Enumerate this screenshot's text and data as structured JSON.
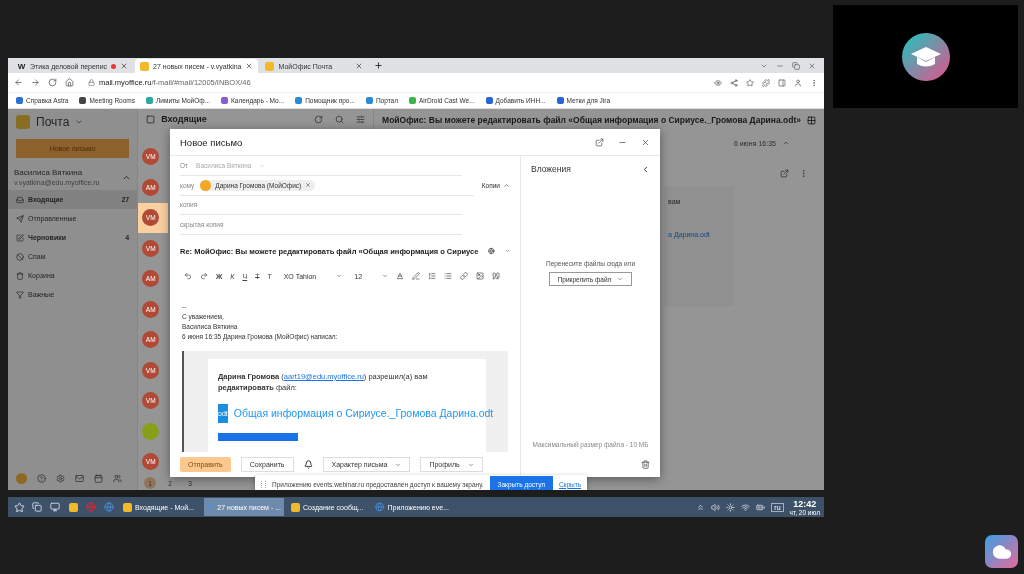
{
  "browser": {
    "tabs": [
      {
        "label": "Этика деловой перепис",
        "icon_text": "W",
        "kind": "doc",
        "recording": true,
        "selected": false
      },
      {
        "label": "27 новых писем - v.vyatkina",
        "kind": "mail",
        "recording": false,
        "selected": true
      },
      {
        "label": "МойОфис Почта",
        "kind": "mail",
        "recording": false,
        "selected": false
      }
    ],
    "url_host": "mail.myoffice.ru",
    "url_path": "/f-mail/#mail/12005/INBOX/46",
    "bookmarks": [
      "Справка Astra",
      "Meeting Rooms",
      "Лимиты МойОф...",
      "Календарь - Мо...",
      "Помощник про...",
      "Портал",
      "AirDroid Cast We...",
      "Добавить ИНН...",
      "Метки для Jira"
    ]
  },
  "mail": {
    "app_title": "Почта",
    "new_button": "Новое письмо",
    "account_name": "Василиса Вяткина",
    "account_email": "v.vyatkina@edu.myoffice.ru",
    "folders": [
      {
        "label": "Входящие",
        "count": "27",
        "selected": true,
        "unread": true
      },
      {
        "label": "Отправленные",
        "selected": false,
        "unread": false
      },
      {
        "label": "Черновики",
        "count": "4",
        "selected": false,
        "unread": true
      },
      {
        "label": "Спам",
        "selected": false,
        "unread": false
      },
      {
        "label": "Корзина",
        "selected": false,
        "unread": false
      },
      {
        "label": "Важные",
        "selected": false,
        "unread": false
      }
    ],
    "list_title": "Входящие",
    "select_all_checked": false,
    "avatars": [
      {
        "initials": "VM",
        "color": "#b04a36",
        "selected": false
      },
      {
        "initials": "AM",
        "color": "#b04a36",
        "selected": false
      },
      {
        "initials": "VM",
        "color": "#b04a36",
        "selected": true
      },
      {
        "initials": "VM",
        "color": "#b04a36",
        "selected": false
      },
      {
        "initials": "AM",
        "color": "#b04a36",
        "selected": false
      },
      {
        "initials": "AM",
        "color": "#b04a36",
        "selected": false
      },
      {
        "initials": "AM",
        "color": "#b04a36",
        "selected": false
      },
      {
        "initials": "VM",
        "color": "#b04a36",
        "selected": false
      },
      {
        "initials": "VM",
        "color": "#b04a36",
        "selected": false
      },
      {
        "color": "#86a01a",
        "selected": false
      },
      {
        "initials": "VM",
        "color": "#b04a36",
        "selected": false
      }
    ],
    "pages": [
      {
        "label": "1",
        "selected": true
      },
      {
        "label": "2",
        "selected": false
      },
      {
        "label": "3",
        "selected": false
      }
    ],
    "reader": {
      "subject": "МойОфис: Вы можете редактировать файл «Общая информация о Сириусе._Громова Дарина.odt»",
      "date": "6 июня 16:35",
      "fragments": [
        "вам",
        "а Дарина.odt"
      ]
    }
  },
  "compose": {
    "title": "Новое письмо",
    "from_label": "От",
    "from_value": "Василиса Вяткина",
    "to_label": "кому",
    "recipient": "Дарина Громова (МойОфис)",
    "copies_toggle": "Копии",
    "cc_label": "копия",
    "bcc_label": "скрытая копия",
    "subject": "Re: МойОфис: Вы можете редактировать файл «Общая информация о Сириусе",
    "format_buttons": [
      "Ж",
      "К",
      "Ч",
      "Т",
      "T"
    ],
    "font": "XO Tahion",
    "size": "12",
    "body_lines": [
      "--",
      "С уважением,",
      "Василиса Вяткина",
      "6 июня 16:35 Дарина Громова (МойОфис) написал:"
    ],
    "quote": {
      "before": "**Дарина Громова** (",
      "email": "aart19@edu.myoffice.ru",
      "after": ") разрешил(а) вам **редактировать** файл:",
      "file_badge": "odt",
      "file_link": "Общая информация о Сириусе._Громова Дарина.odt"
    },
    "send": "Отправить",
    "save": "Сохранить",
    "dropdowns": [
      "Характер письма",
      "Профиль"
    ],
    "attachments": {
      "title": "Вложения",
      "hint": "Перенесите файлы сюда или",
      "attach_button": "Прикрепить файл",
      "limit": "Максимальный размер файла - 10 МБ"
    }
  },
  "share_bar": {
    "text": "Приложению events.webinar.ru предоставлен доступ к вашему экрану.",
    "stop": "Закрыть доступ",
    "hide": "Скрыть"
  },
  "taskbar": {
    "items": [
      {
        "label": "Входящие - Мой...",
        "kind": "mail",
        "selected": false
      },
      {
        "label": "27 новых писем - ...",
        "kind": "chrome",
        "selected": true
      },
      {
        "label": "Создание сообщ...",
        "kind": "mail",
        "selected": false
      },
      {
        "label": "Приложению eve...",
        "kind": "chrome",
        "selected": false
      }
    ],
    "lang": "ru",
    "time": "12:42",
    "date": "чт, 20 июл"
  }
}
